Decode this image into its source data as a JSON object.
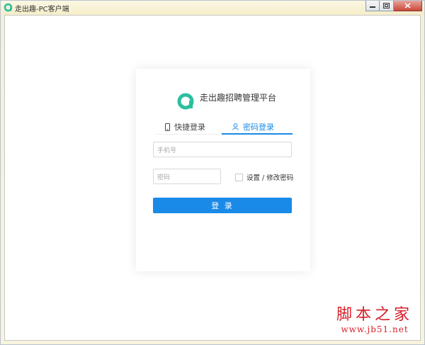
{
  "window": {
    "title": "走出趣-PC客户端",
    "controls": [
      "minimize",
      "restore",
      "close"
    ]
  },
  "brand": {
    "name": "走出趣招聘管理平台",
    "color": "#2bbf9f"
  },
  "tabs": [
    {
      "label": "快捷登录",
      "icon": "phone-icon",
      "active": false
    },
    {
      "label": "密码登录",
      "icon": "user-icon",
      "active": true
    }
  ],
  "form": {
    "phone_placeholder": "手机号",
    "password_placeholder": "密码",
    "set_password_label": "设置 / 修改密码",
    "login_button": "登 录"
  },
  "accent_color": "#1a8ae8",
  "watermark": {
    "title": "脚本之家",
    "url": "www.jb51.net"
  }
}
